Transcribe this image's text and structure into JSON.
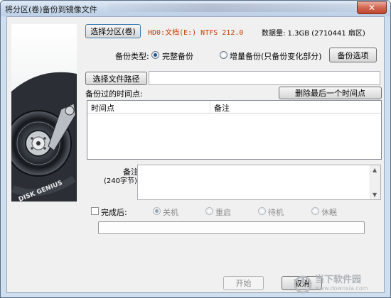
{
  "window": {
    "title": "将分区(卷)备份到镜像文件",
    "close_glyph": "✕"
  },
  "partition": {
    "select_button": "选择分区(卷)",
    "name": "HD0:文档(E:) NTFS 212.0",
    "data_amount": "数据量: 1.3GB (2710441 扇区)"
  },
  "backup_type": {
    "label": "备份类型:",
    "options": [
      {
        "label": "完整备份",
        "checked": true
      },
      {
        "label": "增量备份(只备份变化部分)",
        "checked": false
      }
    ],
    "options_button": "备份选项"
  },
  "file_path": {
    "select_button": "选择文件路径",
    "value": ""
  },
  "timepoints": {
    "label": "备份过的时间点:",
    "delete_button": "删除最后一个时间点",
    "columns": [
      "时间点",
      "备注"
    ],
    "rows": []
  },
  "note": {
    "label": "备注:",
    "limit": "(240字节)",
    "value": ""
  },
  "after_complete": {
    "label": "完成后:",
    "checked": false,
    "options": [
      {
        "label": "关机",
        "checked": true
      },
      {
        "label": "重启",
        "checked": false
      },
      {
        "label": "待机",
        "checked": false
      },
      {
        "label": "休眠",
        "checked": false
      }
    ]
  },
  "progress": {
    "value": 0
  },
  "buttons": {
    "start": "开始",
    "cancel": "取消"
  },
  "disk_image_label": "DISK GENIUS",
  "watermark": {
    "text": "当下软件园",
    "url": "www.downxia.com"
  },
  "colors": {
    "partition_name": "#c04000",
    "title_bar": "#c6d7ea",
    "client_bg": "#f0f0f0"
  },
  "icons": {
    "close": "close-icon",
    "disk": "hard-disk-icon",
    "watermark_logo": "power-logo-icon"
  }
}
